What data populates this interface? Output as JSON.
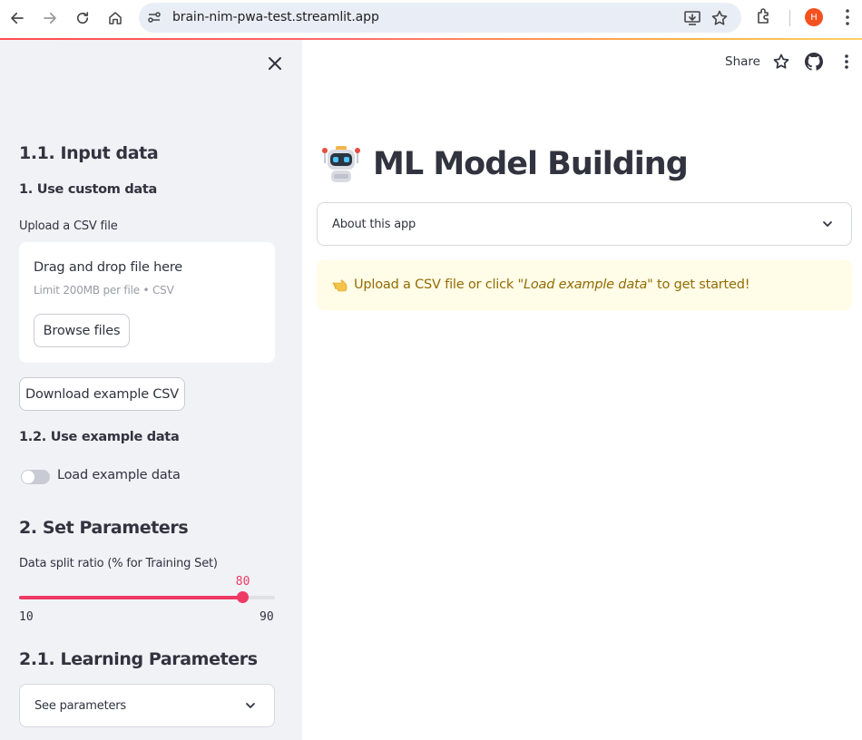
{
  "browser": {
    "url": "brain-nim-pwa-test.streamlit.app",
    "profile_initial": "H",
    "accent_colors": [
      "#ff4b4b",
      "#ffd166"
    ]
  },
  "sidebar": {
    "section_input": "1.1. Input data",
    "custom_data_heading": "1. Use custom data",
    "upload_label": "Upload a CSV file",
    "dropzone": {
      "title": "Drag and drop file here",
      "subtitle": "Limit 200MB per file • CSV",
      "browse_label": "Browse files"
    },
    "download_label": "Download example CSV",
    "example_heading": "1.2. Use example data",
    "toggle": {
      "label": "Load example data",
      "checked": false
    },
    "params_heading": "2. Set Parameters",
    "slider": {
      "label": "Data split ratio (% for Training Set)",
      "value": "80",
      "min": "10",
      "max": "90",
      "color": "#ee3a64"
    },
    "learning_heading": "2.1. Learning Parameters",
    "see_params_label": "See parameters"
  },
  "main": {
    "share_label": "Share",
    "title": "ML Model Building",
    "about_label": "About this app",
    "info": {
      "prefix": "Upload a CSV file or click ",
      "emphasis": "\"Load example data\"",
      "suffix": " to get started!",
      "color": "#926c05",
      "background": "#fffce7"
    }
  }
}
